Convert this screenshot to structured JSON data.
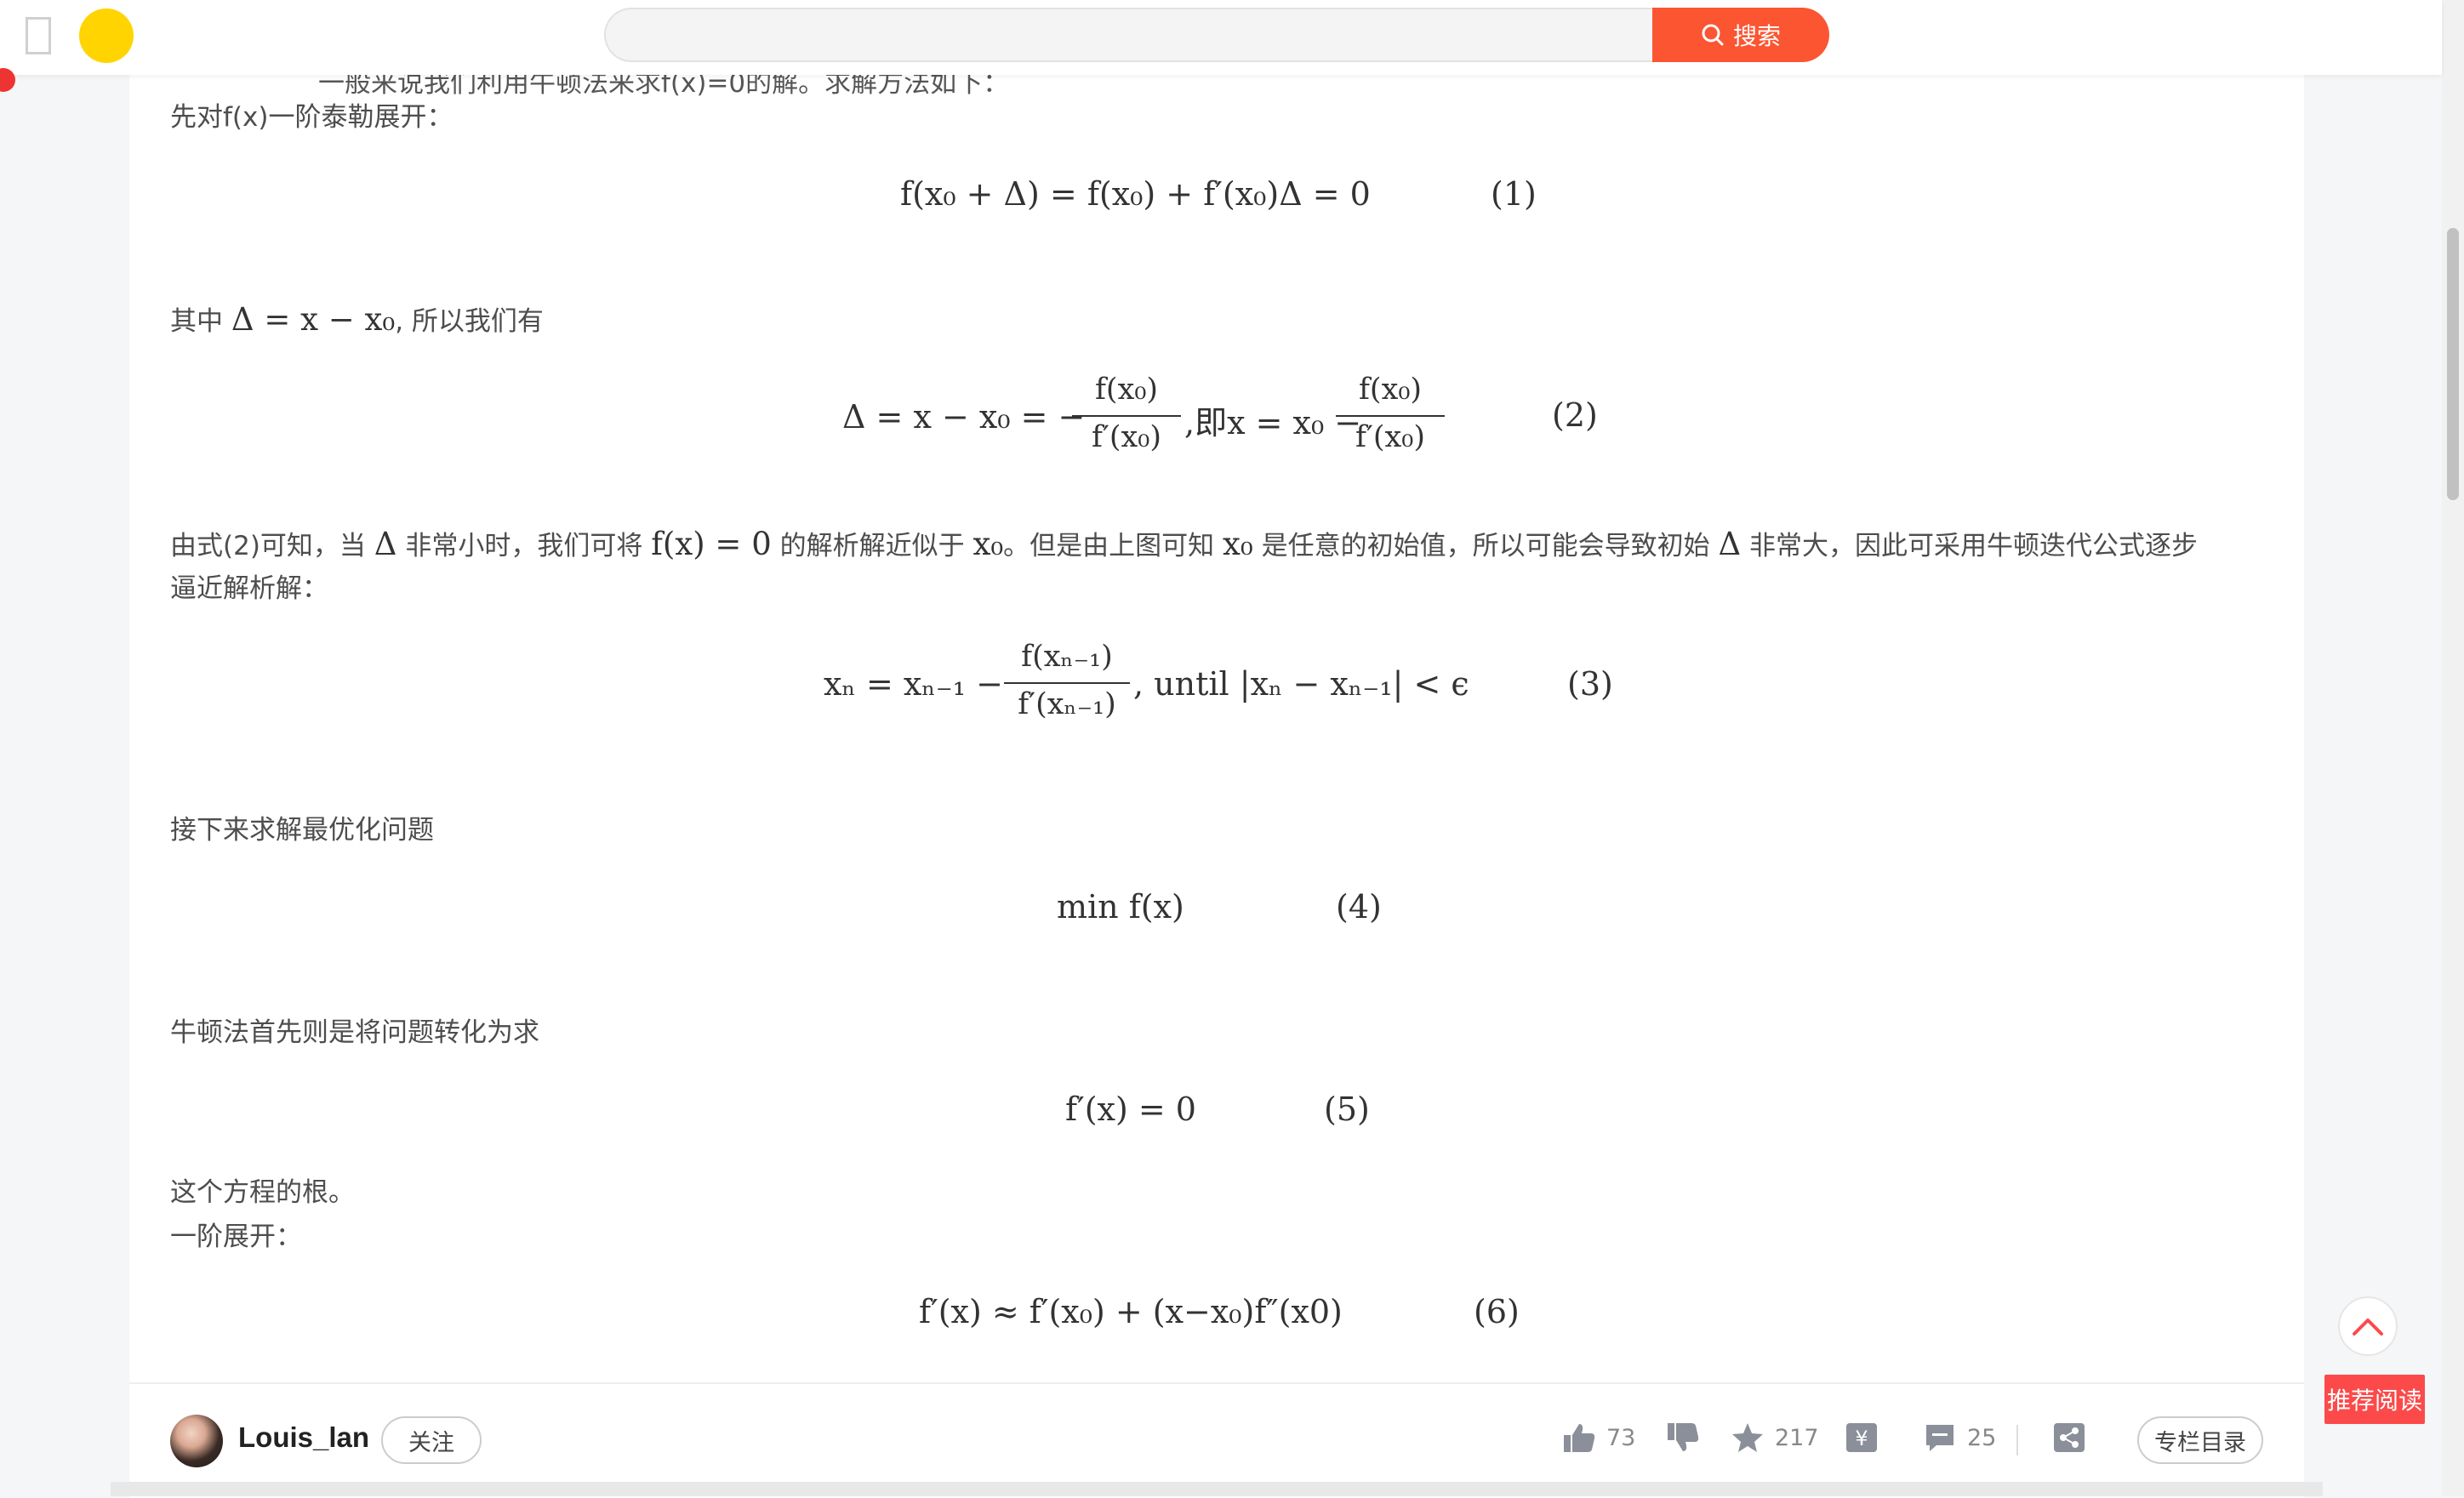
{
  "search": {
    "placeholder": "",
    "button_label": "搜索"
  },
  "article": {
    "partial_top_line": "一般来说我们利用牛顿法来求f(x)=0的解。求解方法如下：",
    "p1": "先对f(x)一阶泰勒展开：",
    "eq1": "f(x₀ + Δ) = f(x₀) + f′(x₀)Δ = 0",
    "eq1_num": "(1)",
    "p2_prefix": "其中",
    "p2_math": "Δ = x − x₀",
    "p2_suffix": ", 所以我们有",
    "eq2_left": "Δ = x − x₀ = −",
    "eq2_frac_num": "f(x₀)",
    "eq2_frac_den": "f′(x₀)",
    "eq2_mid": ",即x = x₀ −",
    "eq2_num": "(2)",
    "p3_a": "由式(2)可知，当",
    "p3_m1": "Δ",
    "p3_b": "非常小时，我们可将",
    "p3_m2": "f(x) = 0",
    "p3_c": "的解析解近似于",
    "p3_m3": "x₀",
    "p3_d": "。但是由上图可知",
    "p3_m4": "x₀",
    "p3_e": "是任意的初始值，所以可能会导致初始",
    "p3_m5": "Δ",
    "p3_f": "非常大，因此可采用牛顿迭代公式逐步",
    "p3_line2": "逼近解析解：",
    "eq3_left": "xₙ = xₙ₋₁ −",
    "eq3_frac_num": "f(xₙ₋₁)",
    "eq3_frac_den": "f′(xₙ₋₁)",
    "eq3_right": ", until  |xₙ − xₙ₋₁| < ϵ",
    "eq3_num": "(3)",
    "p4": "接下来求解最优化问题",
    "eq4": "min    f(x)",
    "eq4_num": "(4)",
    "p5": "牛顿法首先则是将问题转化为求",
    "eq5": "f′(x) = 0",
    "eq5_num": "(5)",
    "p6": "这个方程的根。",
    "p7": "一阶展开：",
    "eq6": "f′(x) ≈ f′(x₀) + (x−x₀)f″(x0)",
    "eq6_num": "(6)"
  },
  "floating": {
    "recommend_label": "推荐阅读"
  },
  "bottom": {
    "author": "Louis_lan",
    "follow_label": "关注",
    "like_count": "73",
    "collect_count": "217",
    "comment_count": "25",
    "catalog_label": "专栏目录"
  },
  "colors": {
    "accent": "#fc5531",
    "recommend": "#fc4a4a",
    "yellow": "#ffd400"
  }
}
